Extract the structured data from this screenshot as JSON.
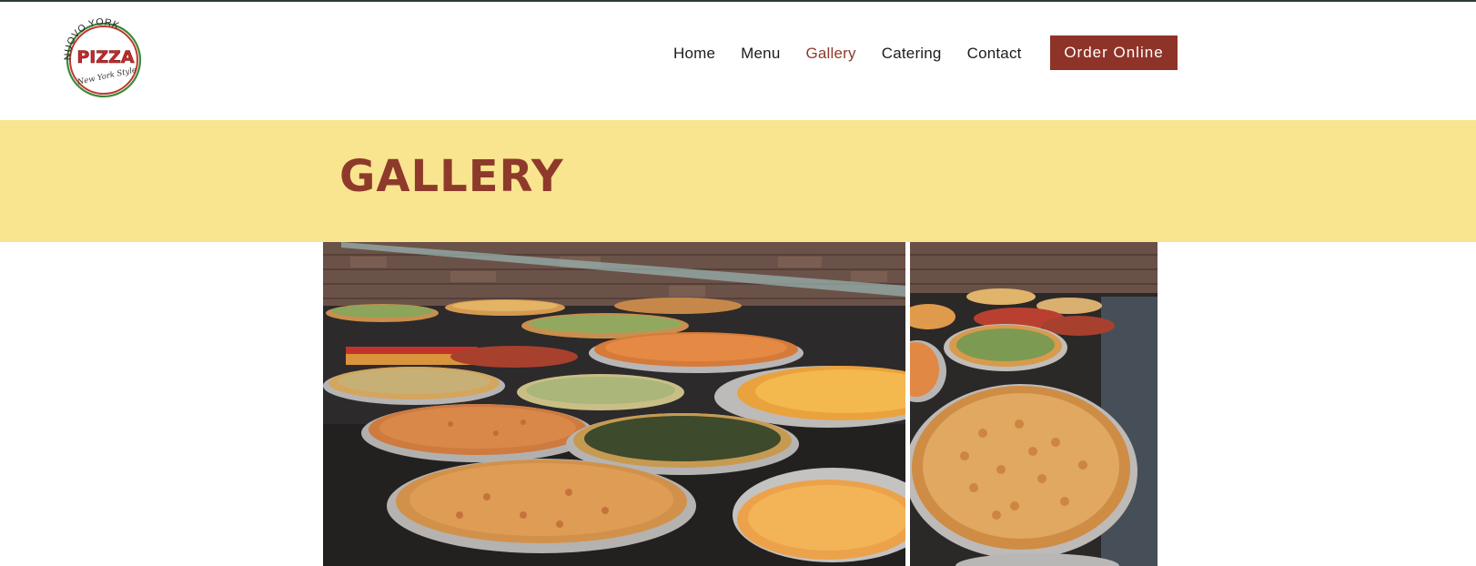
{
  "logo": {
    "top_text": "NUOVO YORK",
    "main_text": "PIZZA",
    "script_text": "New York Style",
    "icon": "pizza-logo-icon"
  },
  "nav": {
    "items": [
      {
        "label": "Home",
        "active": false
      },
      {
        "label": "Menu",
        "active": false
      },
      {
        "label": "Gallery",
        "active": true
      },
      {
        "label": "Catering",
        "active": false
      },
      {
        "label": "Contact",
        "active": false
      }
    ],
    "order_button": "Order Online"
  },
  "banner": {
    "title": "GALLERY"
  },
  "colors": {
    "brand_red": "#8e3328",
    "banner_yellow": "#f9e48f",
    "active_nav": "#8e3a2b",
    "top_rule": "#2f3b36"
  },
  "gallery": {
    "photos": [
      {
        "subject": "pizza display case with many whole pies"
      },
      {
        "subject": "close-up of pizzas in display case"
      }
    ]
  }
}
